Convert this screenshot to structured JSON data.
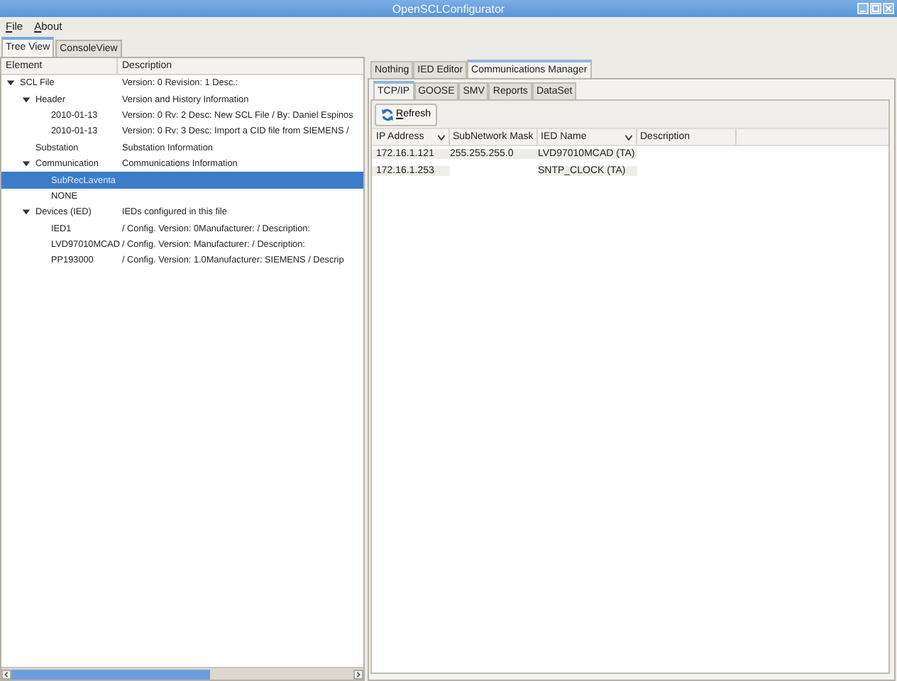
{
  "window": {
    "title": "OpenSCLConfigurator"
  },
  "menu": [
    {
      "label": "File"
    },
    {
      "label": "About"
    }
  ],
  "main_tabs": [
    {
      "label": "Tree View",
      "selected": true
    },
    {
      "label": "ConsoleView",
      "selected": false
    }
  ],
  "tree": {
    "columns": [
      "Element",
      "Description"
    ],
    "items": [
      {
        "element": "SCL File",
        "description": "Version: 0 Revision: 1 Desc.:",
        "expanded": true,
        "selected": false,
        "children": [
          {
            "element": "Header",
            "description": "Version and History Information",
            "expanded": true,
            "selected": false,
            "children": [
              {
                "element": "2010-01-13",
                "description": "Version: 0 Rv: 2 Desc: New SCL File / By: Daniel Espinos",
                "selected": false
              },
              {
                "element": "2010-01-13",
                "description": "Version: 0 Rv: 3 Desc: Import a CID file from SIEMENS /",
                "selected": false
              }
            ]
          },
          {
            "element": "Substation",
            "description": "Substation Information",
            "selected": false
          },
          {
            "element": "Communication",
            "description": "Communications Information",
            "expanded": true,
            "selected": false,
            "children": [
              {
                "element": "SubRecLaventa",
                "selected": true
              },
              {
                "element": "NONE",
                "selected": false
              }
            ]
          },
          {
            "element": "Devices (IED)",
            "description": "IEDs configured in this file",
            "expanded": true,
            "selected": false,
            "children": [
              {
                "element": "IED1",
                "description": " / Config. Version: 0Manufacturer:  / Description:",
                "selected": false
              },
              {
                "element": "LVD97010MCAD",
                "description": " / Config. Version: Manufacturer:  / Description:",
                "selected": false
              },
              {
                "element": "PP193000",
                "description": " / Config. Version: 1.0Manufacturer: SIEMENS / Descrip",
                "selected": false
              }
            ]
          }
        ]
      }
    ]
  },
  "editor_tabs": [
    {
      "label": "Nothing",
      "selected": false
    },
    {
      "label": "IED Editor",
      "selected": false
    },
    {
      "label": "Communications Manager",
      "selected": true
    }
  ],
  "comm_tabs": [
    {
      "label": "TCP/IP",
      "selected": true
    },
    {
      "label": "GOOSE",
      "selected": false
    },
    {
      "label": "SMV",
      "selected": false
    },
    {
      "label": "Reports",
      "selected": false
    },
    {
      "label": "DataSet",
      "selected": false
    }
  ],
  "refresh_button": {
    "label": "Refresh"
  },
  "table": {
    "columns": [
      {
        "label": "IP Address",
        "dropdown": true
      },
      {
        "label": "SubNetwork Mask"
      },
      {
        "label": "IED Name",
        "dropdown": true
      },
      {
        "label": "Description"
      }
    ],
    "rows": [
      [
        "172.16.1.121",
        "255.255.255.0",
        "LVD97010MCAD (TA)"
      ],
      [
        "172.16.1.253",
        "",
        "SNTP_CLOCK (TA)"
      ]
    ]
  }
}
